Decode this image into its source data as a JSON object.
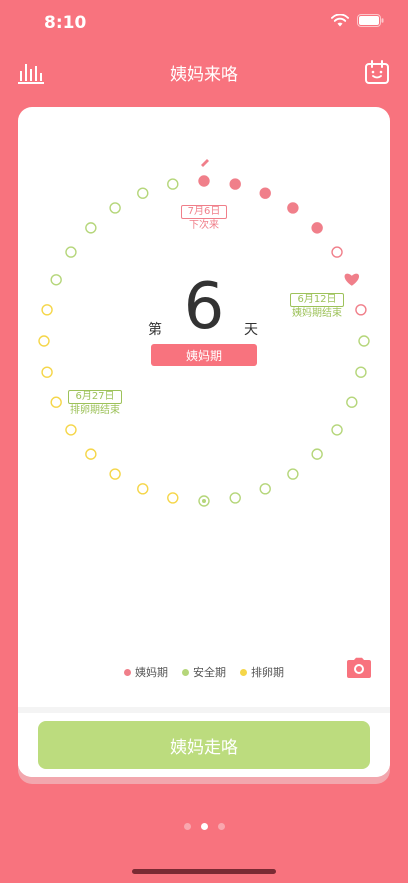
{
  "status": {
    "time": "8:10"
  },
  "header": {
    "title": "姨妈来咯"
  },
  "cycle": {
    "day_prefix": "第",
    "day_number": "6",
    "day_suffix": "天",
    "phase": "姨妈期",
    "total_days": 32,
    "current_day": 6
  },
  "markers": {
    "next": {
      "date": "7月6日",
      "label": "下次来"
    },
    "period_end": {
      "date": "6月12日",
      "label": "姨妈期结束"
    },
    "ovulation_end": {
      "date": "6月27日",
      "label": "排卵期结束"
    }
  },
  "legend": [
    {
      "label": "姨妈期",
      "color": "#f07f8a"
    },
    {
      "label": "安全期",
      "color": "#b5d67a"
    },
    {
      "label": "排卵期",
      "color": "#f5d649"
    }
  ],
  "action": {
    "button_label": "姨妈走咯"
  },
  "colors": {
    "period": "#f07f8a",
    "safe": "#b5d67a",
    "ovulation": "#f5d649",
    "accent": "#f8737e"
  },
  "pager": {
    "count": 3,
    "active": 1
  }
}
